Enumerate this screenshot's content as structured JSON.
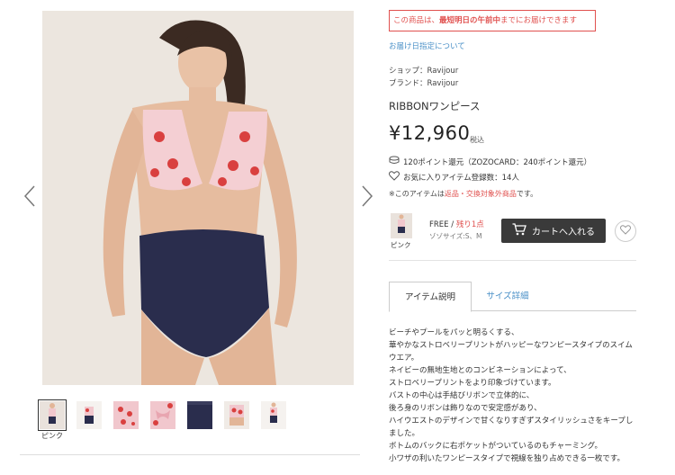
{
  "gallery": {
    "thumb_caption": "ピンク",
    "thumb_count": 7,
    "active_index": 0
  },
  "notice": {
    "prefix": "この商品は、",
    "emphasis": "最短明日の午前中",
    "suffix": "までにお届けできます"
  },
  "delivery_link": "お届け日指定について",
  "shop": "ショップ：Ravijour",
  "brand": "ブランド：Ravijour",
  "product_name": "RIBBONワンピース",
  "price": "¥12,960",
  "tax_label": "税込",
  "points": "120ポイント還元（ZOZOCARD：240ポイント還元）",
  "favorites": "お気に入りアイテム登録数：14人",
  "return_note": {
    "prefix": "※このアイテムは",
    "emphasis": "返品・交換対象外商品",
    "suffix": "です。"
  },
  "sku": {
    "color": "ピンク",
    "size": "FREE",
    "separator": " / ",
    "stock": "残り1点",
    "size_jp": "ゾゾサイズ:S、M"
  },
  "cart_label": "カートへ入れる",
  "tabs": [
    {
      "label": "アイテム説明"
    },
    {
      "label": "サイズ詳細"
    }
  ],
  "description": [
    "ビーチやプールをパッと明るくする、",
    "華やかなストロベリープリントがハッピーなワンピースタイプのスイムウエア。",
    "ネイビーの無地生地とのコンビネーションによって、",
    "ストロベリープリントをより印象づけています。",
    "バストの中心は手結びリボンで立体的に、",
    "後ろ身のリボンは飾りなので安定感があり、",
    "ハイウエストのデザインで甘くなりすぎずスタイリッシュさをキープしました。",
    "ボトムのバックに右ポケットがついているのもチャーミング。",
    "小ワザの利いたワンピースタイプで視線を独り占めできる一枚です。"
  ],
  "colors": {
    "accent_red": "#e0514f",
    "link_blue": "#4a90c7",
    "cart_dark": "#3a3a3a"
  }
}
